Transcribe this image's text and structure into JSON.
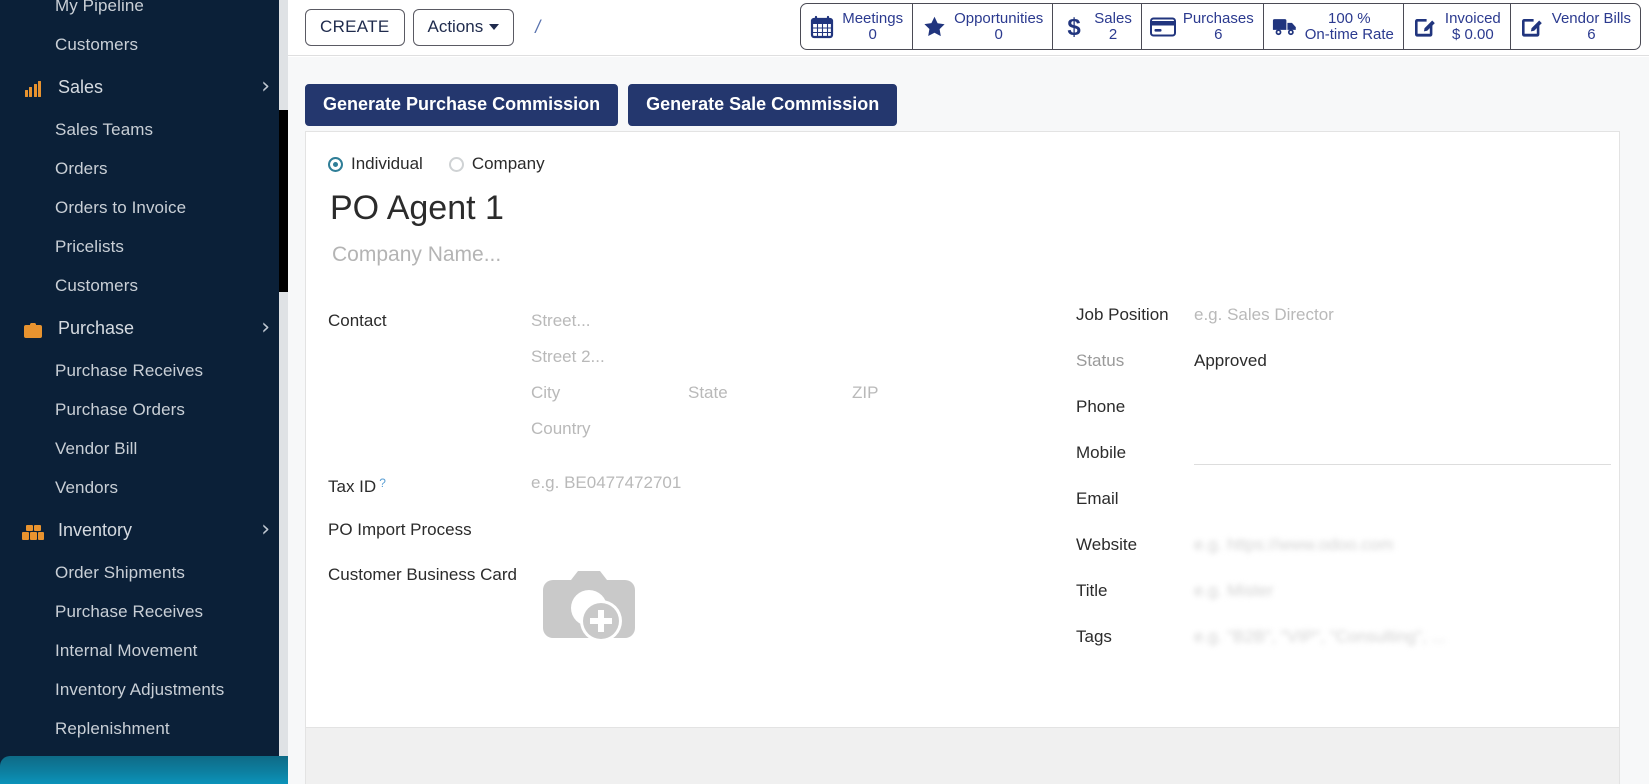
{
  "sidebar": {
    "partial_top_item": "My Pipeline",
    "items": [
      {
        "type": "sub",
        "label": "Customers",
        "name": "customers-top"
      },
      {
        "type": "group",
        "label": "Sales",
        "name": "sales",
        "icon": "bar-chart-icon",
        "chevron": "›"
      },
      {
        "type": "sub",
        "label": "Sales Teams",
        "name": "sales-teams"
      },
      {
        "type": "sub",
        "label": "Orders",
        "name": "orders"
      },
      {
        "type": "sub",
        "label": "Orders to Invoice",
        "name": "orders-to-invoice"
      },
      {
        "type": "sub",
        "label": "Pricelists",
        "name": "pricelists"
      },
      {
        "type": "sub",
        "label": "Customers",
        "name": "customers-sales"
      },
      {
        "type": "group",
        "label": "Purchase",
        "name": "purchase",
        "icon": "briefcase-icon",
        "chevron": "›"
      },
      {
        "type": "sub",
        "label": "Purchase Receives",
        "name": "purchase-receives"
      },
      {
        "type": "sub",
        "label": "Purchase Orders",
        "name": "purchase-orders"
      },
      {
        "type": "sub",
        "label": "Vendor Bill",
        "name": "vendor-bill"
      },
      {
        "type": "sub",
        "label": "Vendors",
        "name": "vendors"
      },
      {
        "type": "group",
        "label": "Inventory",
        "name": "inventory",
        "icon": "boxes-icon",
        "chevron": "›"
      },
      {
        "type": "sub",
        "label": "Order Shipments",
        "name": "order-shipments"
      },
      {
        "type": "sub",
        "label": "Purchase Receives",
        "name": "purchase-receives-inv"
      },
      {
        "type": "sub",
        "label": "Internal Movement",
        "name": "internal-movement"
      },
      {
        "type": "sub",
        "label": "Inventory Adjustments",
        "name": "inventory-adjustments"
      },
      {
        "type": "sub",
        "label": "Replenishment",
        "name": "replenishment"
      }
    ]
  },
  "control_panel": {
    "create_label": "CREATE",
    "actions_label": "Actions",
    "breadcrumb": "/",
    "stats": [
      {
        "icon": "calendar-icon",
        "line1": "Meetings",
        "line2": "0"
      },
      {
        "icon": "star-icon",
        "line1": "Opportunities",
        "line2": "0"
      },
      {
        "icon": "dollar-icon",
        "line1": "Sales",
        "line2": "2"
      },
      {
        "icon": "credit-card-icon",
        "line1": "Purchases",
        "line2": "6"
      },
      {
        "icon": "truck-icon",
        "line1": "100 %",
        "line2": "On-time Rate"
      },
      {
        "icon": "pencil-square-icon",
        "line1": "Invoiced",
        "line2": "$ 0.00"
      },
      {
        "icon": "pencil-square-icon",
        "line1": "Vendor Bills",
        "line2": "6"
      }
    ]
  },
  "actions": {
    "generate_purchase_commission": "Generate Purchase Commission",
    "generate_sale_commission": "Generate Sale Commission"
  },
  "form": {
    "radio": {
      "individual": "Individual",
      "company": "Company",
      "selected": "Individual"
    },
    "title": "PO Agent 1",
    "company_name_placeholder": "Company Name...",
    "left": {
      "contact_label": "Contact",
      "street_placeholder": "Street...",
      "street2_placeholder": "Street 2...",
      "city_placeholder": "City",
      "state_placeholder": "State",
      "zip_placeholder": "ZIP",
      "country_placeholder": "Country",
      "tax_id_label": "Tax ID",
      "tax_id_help": "?",
      "tax_id_placeholder": "e.g. BE0477472701",
      "po_import_process_label": "PO Import Process",
      "po_import_process_value": "",
      "business_card_label": "Customer Business Card",
      "business_card_icon": "camera-add-icon"
    },
    "right": [
      {
        "label": "Job Position",
        "value": "",
        "placeholder": "e.g. Sales Director",
        "name": "job-position"
      },
      {
        "label": "Status",
        "value": "Approved",
        "placeholder": "",
        "name": "status",
        "muted_label": true
      },
      {
        "label": "Phone",
        "value": "",
        "placeholder": "",
        "name": "phone"
      },
      {
        "label": "Mobile",
        "value": "",
        "placeholder": "",
        "name": "mobile",
        "underline": true
      },
      {
        "label": "Email",
        "value": "",
        "placeholder": "",
        "name": "email"
      },
      {
        "label": "Website",
        "value": "",
        "placeholder": "e.g. https://www.odoo.com",
        "name": "website",
        "blurred": true
      },
      {
        "label": "Title",
        "value": "",
        "placeholder": "e.g. Mister",
        "name": "title",
        "blurred": true
      },
      {
        "label": "Tags",
        "value": "",
        "placeholder": "e.g. \"B2B\", \"VIP\", \"Consulting\", ...",
        "name": "tags",
        "blurred": true
      }
    ]
  },
  "colors": {
    "sidebar_bg": "#0b2038",
    "sidebar_accent": "#e8932f",
    "primary_button": "#24376e",
    "stat_text": "#2b3a8f",
    "radio_accent": "#2f7e97",
    "footer_teal": "#0b93ba"
  }
}
